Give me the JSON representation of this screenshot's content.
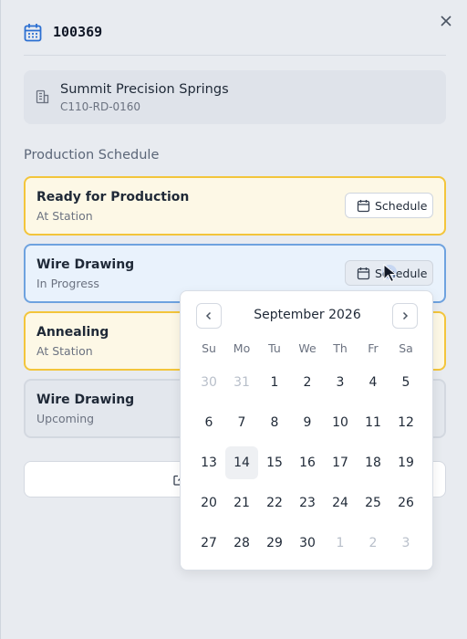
{
  "header": {
    "title": "100369",
    "icon": "calendar-icon"
  },
  "close": {
    "icon": "close-icon"
  },
  "company": {
    "name": "Summit Precision Springs",
    "code": "C110-RD-0160",
    "icon": "building-icon"
  },
  "section": {
    "label": "Production Schedule"
  },
  "steps": [
    {
      "title": "Ready for Production",
      "status": "At Station",
      "button_label": "Schedule",
      "variant": "yellow"
    },
    {
      "title": "Wire Drawing",
      "status": "In Progress",
      "button_label": "Schedule",
      "variant": "blue"
    },
    {
      "title": "Annealing",
      "status": "At Station",
      "variant": "yellow"
    },
    {
      "title": "Wire Drawing",
      "status": "Upcoming",
      "variant": "gray"
    }
  ],
  "calendar": {
    "month": "September 2026",
    "weekdays": [
      "Su",
      "Mo",
      "Tu",
      "We",
      "Th",
      "Fr",
      "Sa"
    ],
    "weeks": [
      [
        "30",
        "31",
        "1",
        "2",
        "3",
        "4",
        "5"
      ],
      [
        "6",
        "7",
        "8",
        "9",
        "10",
        "11",
        "12"
      ],
      [
        "13",
        "14",
        "15",
        "16",
        "17",
        "18",
        "19"
      ],
      [
        "20",
        "21",
        "22",
        "23",
        "24",
        "25",
        "26"
      ],
      [
        "27",
        "28",
        "29",
        "30",
        "1",
        "2",
        "3"
      ]
    ],
    "highlighted_day": "14"
  },
  "colors": {
    "accent_yellow": "#f3c53b",
    "accent_blue": "#6ea2df",
    "header_icon": "#2b6fd1"
  }
}
